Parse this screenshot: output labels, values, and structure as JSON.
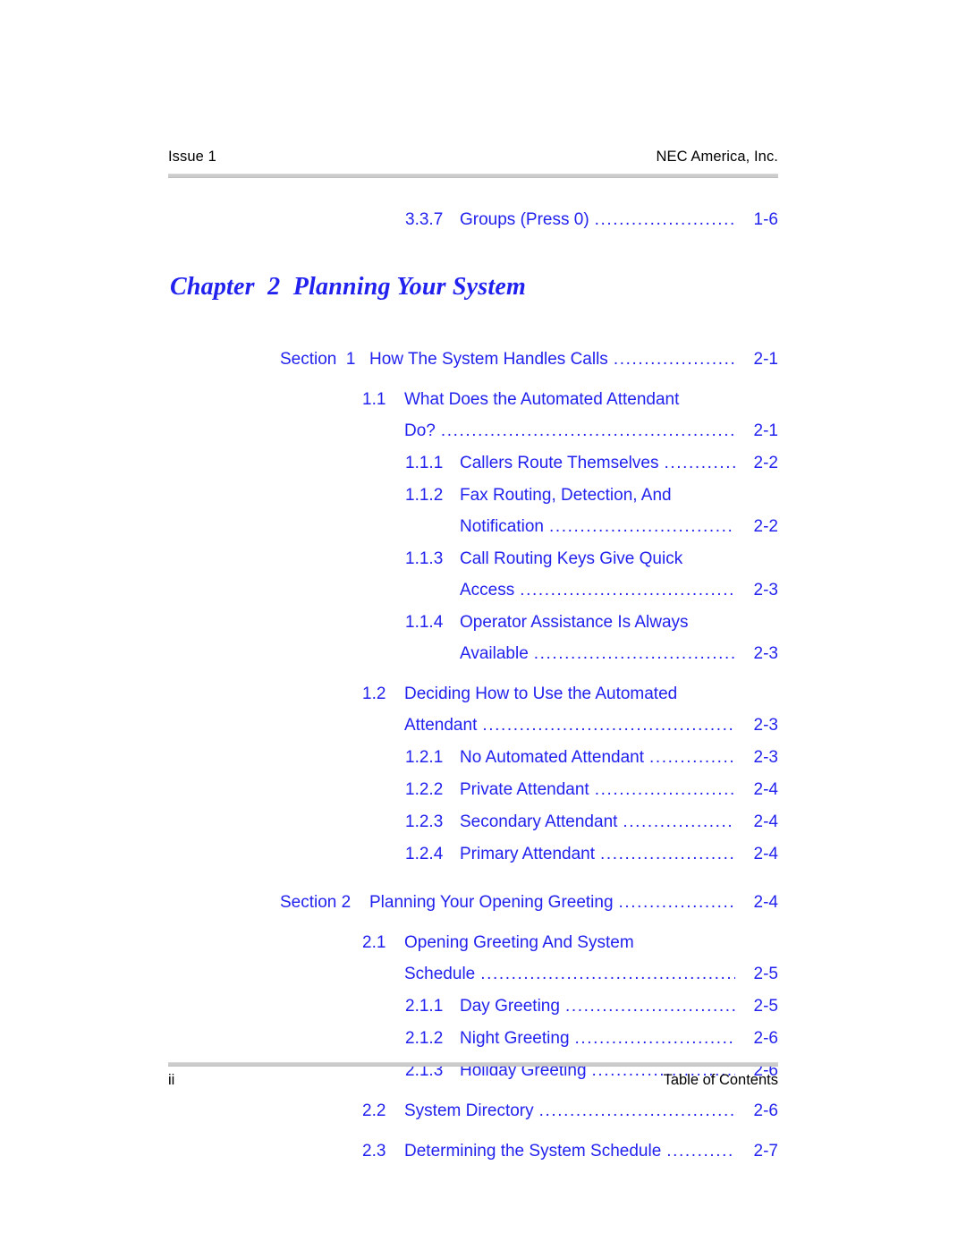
{
  "header": {
    "left": "Issue 1",
    "right": "NEC America, Inc."
  },
  "footer": {
    "left": "ii",
    "right": "Table of Contents"
  },
  "chapter": {
    "title": "Chapter  2  Planning Your System"
  },
  "colors": {
    "entry_blue": "#2222ee",
    "rule_gray": "#cccccc",
    "header_text": "#000000"
  },
  "toc": {
    "pre_entries": [
      {
        "number": "3.3.7",
        "label": "Groups (Press 0)",
        "page": "1-6",
        "level": 3
      }
    ],
    "entries": [
      {
        "number": "Section  1",
        "label": "How The System Handles Calls",
        "page": "2-1",
        "level": "section",
        "leader": true
      },
      {
        "number": "1.1",
        "label": "What Does the Automated Attendant",
        "label2": "Do?",
        "page": "2-1",
        "level": 2
      },
      {
        "number": "1.1.1",
        "label": "Callers Route Themselves",
        "page": "2-2",
        "level": 3
      },
      {
        "number": "1.1.2",
        "label": "Fax Routing, Detection, And",
        "label2": "Notification",
        "page": "2-2",
        "level": 3
      },
      {
        "number": "1.1.3",
        "label": "Call Routing Keys Give Quick",
        "label2": "Access",
        "page": "2-3",
        "level": 3
      },
      {
        "number": "1.1.4",
        "label": "Operator Assistance Is Always",
        "label2": "Available",
        "page": "2-3",
        "level": 3
      },
      {
        "number": "1.2",
        "label": "Deciding How to Use the Automated",
        "label2": "Attendant",
        "page": "2-3",
        "level": 2
      },
      {
        "number": "1.2.1",
        "label": "No Automated Attendant",
        "page": "2-3",
        "level": 3
      },
      {
        "number": "1.2.2",
        "label": "Private Attendant",
        "page": "2-4",
        "level": 3
      },
      {
        "number": "1.2.3",
        "label": "Secondary Attendant",
        "page": "2-4",
        "level": 3
      },
      {
        "number": "1.2.4",
        "label": "Primary Attendant",
        "page": "2-4",
        "level": 3
      },
      {
        "number": "Section 2",
        "label": "Planning Your Opening Greeting",
        "page": "2-4",
        "level": "section",
        "leader": true
      },
      {
        "number": "2.1",
        "label": "Opening Greeting And System",
        "label2": "Schedule",
        "page": "2-5",
        "level": 2
      },
      {
        "number": "2.1.1",
        "label": "Day Greeting",
        "page": "2-5",
        "level": 3
      },
      {
        "number": "2.1.2",
        "label": "Night Greeting",
        "page": "2-6",
        "level": 3
      },
      {
        "number": "2.1.3",
        "label": "Holiday Greeting",
        "page": "2-6",
        "level": 3
      },
      {
        "number": "2.2",
        "label": "System Directory",
        "page": "2-6",
        "level": 2
      },
      {
        "number": "2.3",
        "label": "Determining the System Schedule",
        "page": "2-7",
        "level": 2
      }
    ]
  }
}
